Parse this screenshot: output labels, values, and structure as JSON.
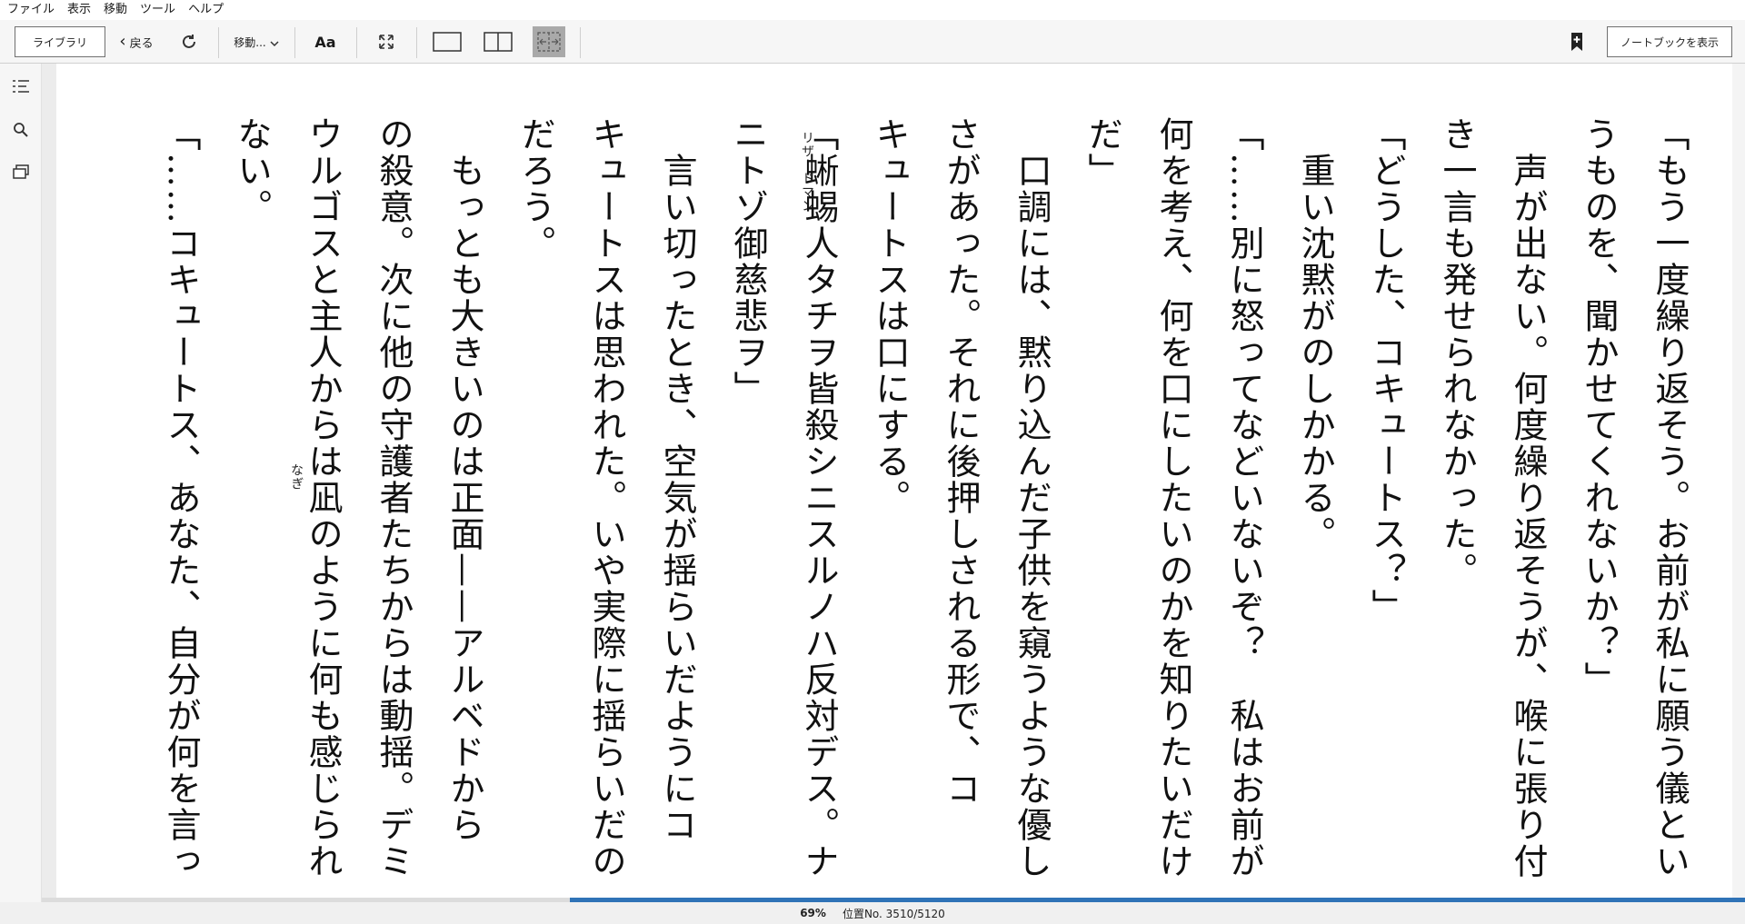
{
  "menu": [
    "ファイル",
    "表示",
    "移動",
    "ツール",
    "ヘルプ"
  ],
  "toolbar": {
    "library_label": "ライブラリ",
    "back_label": "戻る",
    "goto_label": "移動...",
    "font_label": "Aa",
    "notebook_label": "ノートブックを表示"
  },
  "icons": {
    "refresh": "refresh-icon",
    "fullscreen": "fullscreen-icon",
    "single_page": "single-page-icon",
    "two_page": "two-page-icon",
    "width_mode": "fit-width-icon",
    "bookmark": "bookmark-add-icon",
    "toc": "table-of-contents-icon",
    "search": "search-icon",
    "flashcards": "flashcards-icon"
  },
  "book": {
    "lines": [
      "「もう一度繰り返そう。お前が私に願う儀とい",
      "うものを、聞かせてくれないか？」",
      "声が出ない。何度繰り返そうが、喉に張り付",
      "き一言も発せられなかった。",
      "「どうした、コキュートス？」",
      "重い沈黙がのしかかる。",
      "「……別に怒ってなどいないぞ？　私はお前が",
      "何を考え、何を口にしたいのかを知りたいだけ",
      "だ」",
      "口調には、黙り込んだ子供を窺うような優し",
      "さがあった。それに後押しされる形で、コ",
      "キュートスは口にする。",
      "「蜥蜴人タチヲ皆殺シニスルノハ反対デス。ナ",
      "ニトゾ御慈悲ヲ」",
      "言い切ったとき、空気が揺らいだようにコ",
      "キュートスは思われた。いや実際に揺らいだの",
      "だろう。",
      "もっとも大きいのは正面——アルベドから",
      "の殺意。次に他の守護者たちからは動揺。デミ",
      "ウルゴスと主人からは凪のように何も感じられ",
      "ない。",
      "「……コキュートス、あなた、自分が何を言っ"
    ],
    "ruby_lizardman": "リザードマン",
    "ruby_nagi": "なぎ"
  },
  "status": {
    "percent": "69%",
    "location": "位置No. 3510/5120",
    "progress_value": 0.69
  },
  "colors": {
    "accent": "#2f73b7",
    "toolbar_bg": "#f6f6f6",
    "active_mode_bg": "#a9a9a9"
  }
}
